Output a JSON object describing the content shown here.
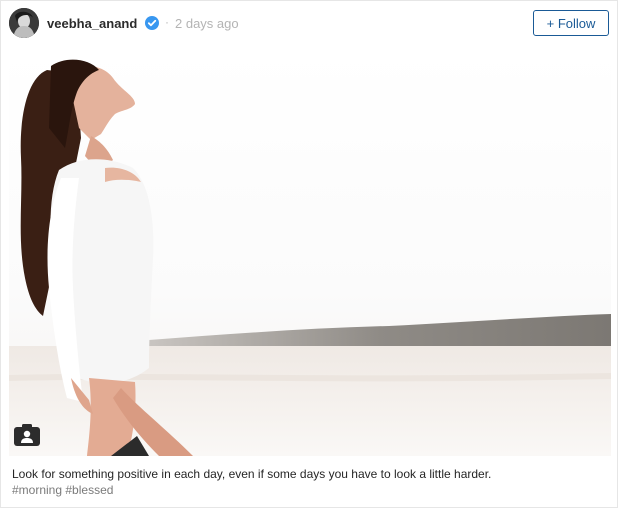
{
  "post": {
    "username": "veebha_anand",
    "separator": "·",
    "timestamp": "2 days ago",
    "follow_label": "+ Follow",
    "caption": "Look for something positive in each day, even if some days you have to look a little harder.",
    "hashtags": [
      "#morning",
      "#blessed"
    ]
  },
  "icons": {
    "avatar": "profile-avatar",
    "verified": "verified-badge-icon",
    "camera": "tagged-people-icon"
  },
  "colors": {
    "follow": "#1a5a96",
    "verified": "#3897f0",
    "hashtag": "#7a7a7a"
  }
}
